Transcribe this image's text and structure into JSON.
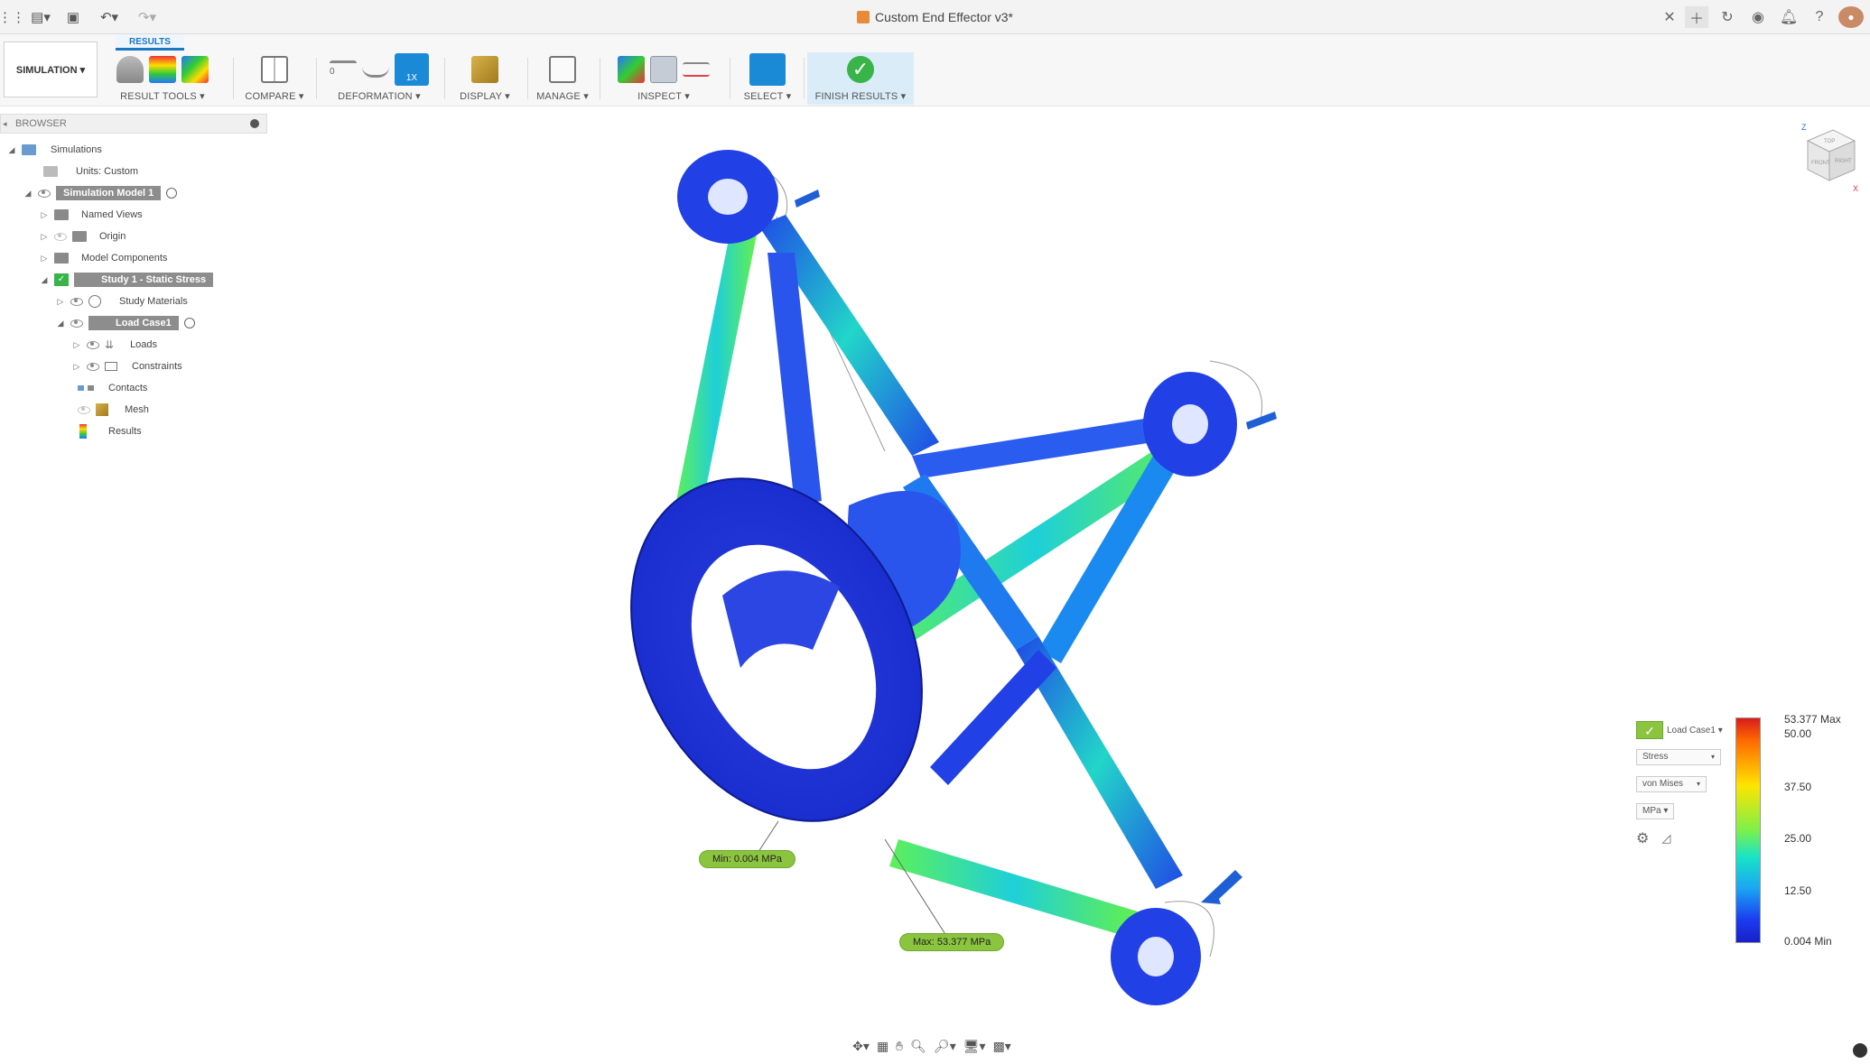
{
  "window": {
    "title": "Custom End Effector v3*"
  },
  "toolbar": {
    "workspace": "SIMULATION ▾",
    "active_tab": "RESULTS"
  },
  "ribbon_groups": [
    {
      "label": "RESULT TOOLS ▾"
    },
    {
      "label": "COMPARE ▾"
    },
    {
      "label": "DEFORMATION ▾"
    },
    {
      "label": "DISPLAY ▾"
    },
    {
      "label": "MANAGE ▾"
    },
    {
      "label": "INSPECT ▾"
    },
    {
      "label": "SELECT ▾"
    },
    {
      "label": "FINISH RESULTS ▾"
    }
  ],
  "deformation": {
    "scale_label": "1X",
    "zero_label": "0"
  },
  "browser": {
    "header": "BROWSER",
    "items": [
      {
        "label": "Simulations"
      },
      {
        "label": "Units: Custom"
      },
      {
        "label": "Simulation Model 1"
      },
      {
        "label": "Named Views"
      },
      {
        "label": "Origin"
      },
      {
        "label": "Model Components"
      },
      {
        "label": "Study 1 - Static Stress"
      },
      {
        "label": "Study Materials"
      },
      {
        "label": "Load Case1"
      },
      {
        "label": "Loads"
      },
      {
        "label": "Constraints"
      },
      {
        "label": "Contacts"
      },
      {
        "label": "Mesh"
      },
      {
        "label": "Results"
      }
    ]
  },
  "legend": {
    "load_case": "Load Case1 ▾",
    "result_type": "Stress",
    "component": "von Mises",
    "units": "MPa ▾",
    "max_label": "53.377 Max",
    "min_label": "0.004 Min",
    "ticks": [
      "50.00",
      "37.50",
      "25.00",
      "12.50"
    ]
  },
  "callouts": {
    "min": "Min: 0.004 MPa",
    "max": "Max: 53.377 MPa"
  },
  "viewcube": {
    "faces": [
      "TOP",
      "FRONT",
      "RIGHT"
    ],
    "axes": [
      "Z",
      "X"
    ]
  },
  "colors": {
    "accent": "#1b77c3",
    "finish": "#38b449",
    "callout": "#8bc53f"
  }
}
